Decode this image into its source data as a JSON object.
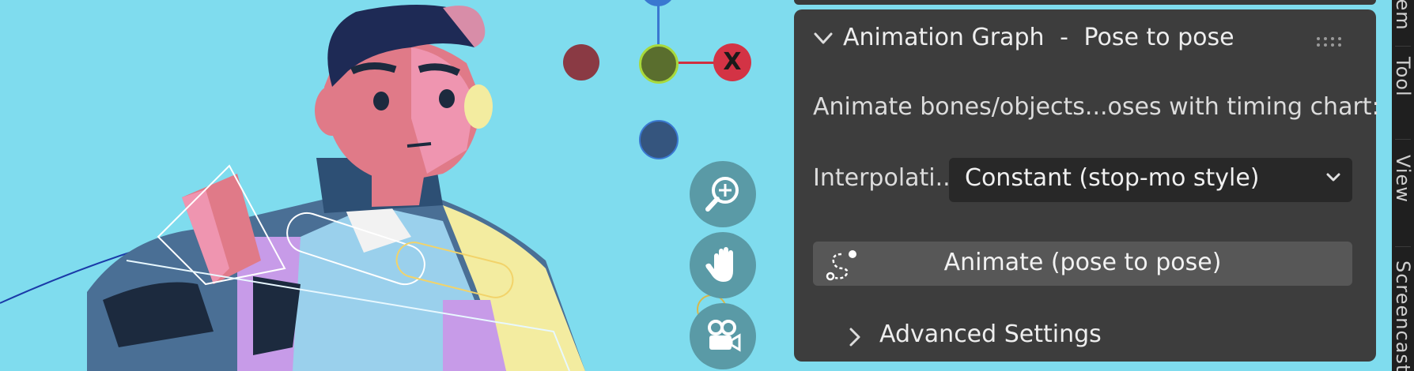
{
  "panel": {
    "title": "Animation Graph",
    "separator": "-",
    "subtitle": "Pose to pose",
    "description": "Animate bones/objects...oses with timing chart:",
    "interpolation_label": "Interpolati...",
    "interpolation_value": "Constant (stop-mo style)",
    "animate_button": "Animate (pose to pose)",
    "advanced_settings": "Advanced Settings"
  },
  "gizmo": {
    "x_label": "X",
    "colors": {
      "x": "#d33345",
      "x_neg": "#8a3a44",
      "y": "#5a6e2e",
      "z_neg": "#35557e",
      "z": "#3a78d0"
    }
  },
  "nav_icons": [
    "zoom-icon",
    "hand-pan-icon",
    "camera-icon"
  ],
  "sidebar_tabs": [
    "Item",
    "Tool",
    "View",
    "Screencast"
  ],
  "colors": {
    "viewport_bg": "#7fdcee",
    "panel_bg": "#3d3d3d",
    "dropdown_bg": "#282828",
    "button_bg": "#575757"
  }
}
